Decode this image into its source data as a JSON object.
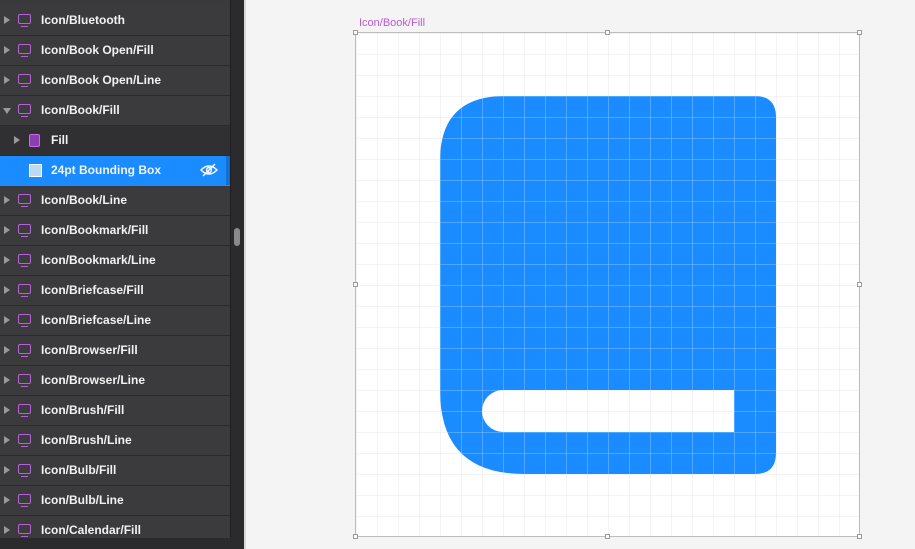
{
  "sidebar": {
    "layers": [
      {
        "label": "Icon/Bluetooth",
        "kind": "artboard",
        "icon": "artboard-icon"
      },
      {
        "label": "Icon/Book Open/Fill",
        "kind": "artboard",
        "icon": "artboard-icon"
      },
      {
        "label": "Icon/Book Open/Line",
        "kind": "artboard",
        "icon": "artboard-icon"
      },
      {
        "label": "Icon/Book/Fill",
        "kind": "artboard",
        "icon": "artboard-icon",
        "expanded": true
      },
      {
        "label": "Fill",
        "kind": "group",
        "icon": "group-icon",
        "child": true
      },
      {
        "label": "24pt Bounding Box",
        "kind": "shape",
        "icon": "square-icon",
        "child": true,
        "selected": true,
        "trailing_icon": "eye-slash-icon"
      },
      {
        "label": "Icon/Book/Line",
        "kind": "artboard",
        "icon": "artboard-icon"
      },
      {
        "label": "Icon/Bookmark/Fill",
        "kind": "artboard",
        "icon": "artboard-icon"
      },
      {
        "label": "Icon/Bookmark/Line",
        "kind": "artboard",
        "icon": "artboard-icon"
      },
      {
        "label": "Icon/Briefcase/Fill",
        "kind": "artboard",
        "icon": "artboard-icon"
      },
      {
        "label": "Icon/Briefcase/Line",
        "kind": "artboard",
        "icon": "artboard-icon"
      },
      {
        "label": "Icon/Browser/Fill",
        "kind": "artboard",
        "icon": "artboard-icon"
      },
      {
        "label": "Icon/Browser/Line",
        "kind": "artboard",
        "icon": "artboard-icon"
      },
      {
        "label": "Icon/Brush/Fill",
        "kind": "artboard",
        "icon": "artboard-icon"
      },
      {
        "label": "Icon/Brush/Line",
        "kind": "artboard",
        "icon": "artboard-icon"
      },
      {
        "label": "Icon/Bulb/Fill",
        "kind": "artboard",
        "icon": "artboard-icon"
      },
      {
        "label": "Icon/Bulb/Line",
        "kind": "artboard",
        "icon": "artboard-icon"
      },
      {
        "label": "Icon/Calendar/Fill",
        "kind": "artboard",
        "icon": "artboard-icon"
      }
    ]
  },
  "canvas": {
    "artboard_title": "Icon/Book/Fill",
    "artboard_icon": "book-fill-icon",
    "icon_color": "#1a8cff",
    "title_color": "#b85ad6",
    "selection_color": "#1a8cff"
  }
}
